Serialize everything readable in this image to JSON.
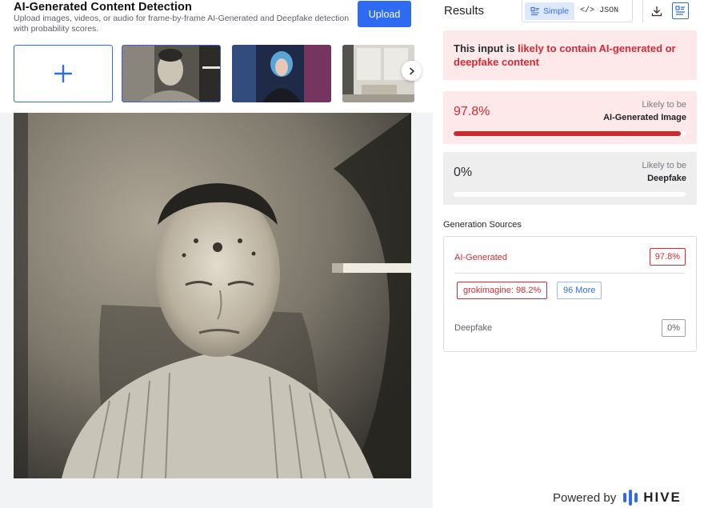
{
  "header": {
    "title": "AI-Generated Content Detection",
    "description": "Upload images, videos, or audio for frame-by-frame AI-Generated and Deepfake detection with probability scores.",
    "upload_label": "Upload"
  },
  "results": {
    "title": "Results",
    "view_modes": [
      {
        "label": "Simple",
        "icon": "list-icon",
        "active": true
      },
      {
        "label": "</> JSON",
        "icon": "code-icon",
        "active": false
      }
    ],
    "verdict_prefix": "This input is ",
    "verdict_highlight": "likely to contain AI-generated or deepfake content",
    "scores": [
      {
        "percent": "97.8%",
        "value": 0.978,
        "likely_label": "Likely to be",
        "category": "AI-Generated Image",
        "color": "#c62b2f"
      },
      {
        "percent": "0%",
        "value": 0.0,
        "likely_label": "Likely to be",
        "category": "Deepfake",
        "color": "#c62b2f"
      }
    ],
    "generation_sources": {
      "title": "Generation Sources",
      "ai_label": "AI-Generated",
      "ai_percent": "97.8%",
      "top_source": "grokimagine: 98.2%",
      "more_label": "96 More",
      "deepfake_label": "Deepfake",
      "deepfake_percent": "0%"
    }
  },
  "footer": {
    "powered_by": "Powered by",
    "brand": "HIVE"
  },
  "colors": {
    "accent": "#2f6bf2",
    "danger": "#d32b35",
    "danger_bg": "#fde8ea"
  }
}
